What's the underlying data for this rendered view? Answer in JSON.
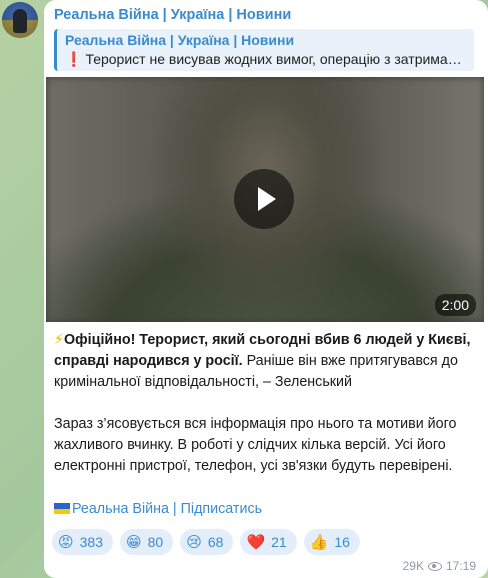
{
  "channel": {
    "name": "Реальна Війна | Україна | Новини"
  },
  "reply": {
    "title": "Реальна Війна | Україна | Новини",
    "icon": "exclamation-icon",
    "text": "Терорист не висував жодних вимог, операцію з затримання"
  },
  "video": {
    "duration": "2:00"
  },
  "post": {
    "lightning": "⚡",
    "bold_part": "Офіційно! Терорист, який сьогодні вбив 6 людей у Києві, справді народився у росії.",
    "normal_part": " Раніше він вже притягувався до кримінальної відповідальності, – Зеленський",
    "paragraph2": "Зараз з’ясовується вся інформація про нього та мотиви його жахливого вчинку. В роботі у слідчих кілька версій. Усі його електронні пристрої, телефон, усі зв'язки будуть перевірені."
  },
  "subscribe": {
    "label": "Реальна Війна | Підписатись"
  },
  "reactions": [
    {
      "emoji": "😡",
      "count": "383"
    },
    {
      "emoji": "😁",
      "count": "80"
    },
    {
      "emoji": "😢",
      "count": "68"
    },
    {
      "emoji": "❤️",
      "count": "21"
    },
    {
      "emoji": "👍",
      "count": "16"
    }
  ],
  "meta": {
    "views": "29K",
    "time": "17:19"
  },
  "colors": {
    "accent": "#3a8bcd",
    "reaction_bg": "#e4eefa",
    "excl": "#d9282f"
  }
}
